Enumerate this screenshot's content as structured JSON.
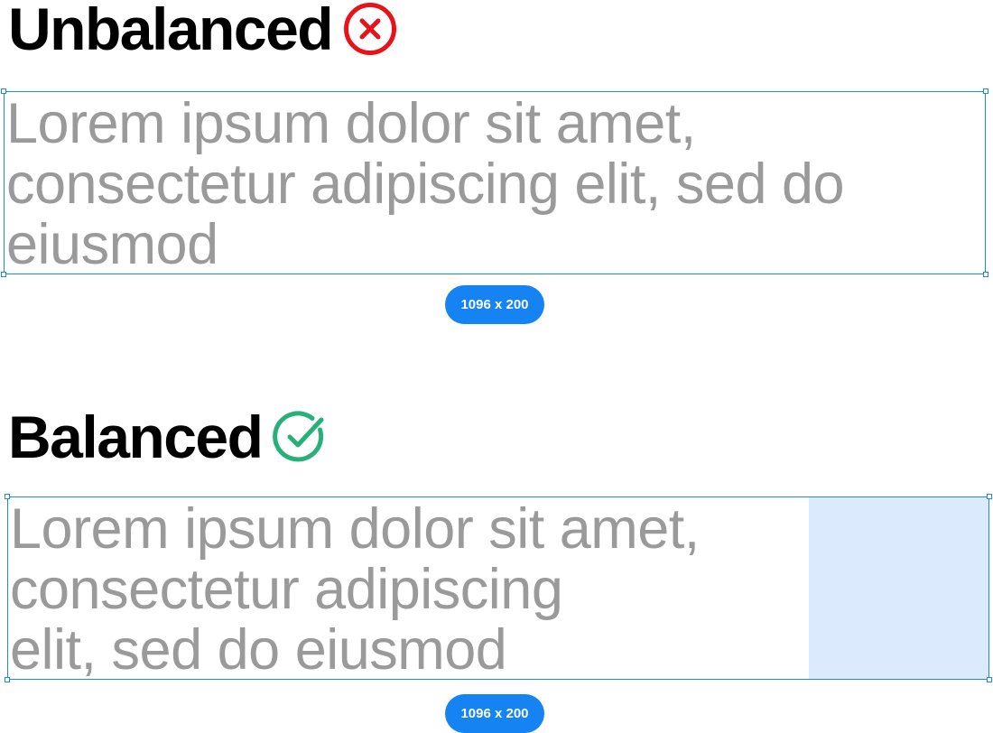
{
  "unbalanced": {
    "heading": "Unbalanced",
    "status_icon": "x-circle-icon",
    "status_color": "#e8121a",
    "text_lines": [
      "Lorem ipsum dolor sit amet,",
      "consectetur adipiscing elit, sed do",
      "eiusmod"
    ],
    "size_label": "1096 x 200"
  },
  "balanced": {
    "heading": "Balanced",
    "status_icon": "check-circle-icon",
    "status_color": "#27b07a",
    "text_lines": [
      "Lorem ipsum dolor sit amet,",
      "consectetur adipiscing",
      "elit, sed do eiusmod"
    ],
    "size_label": "1096 x 200"
  },
  "colors": {
    "frame_border": "#1f8bd6",
    "pill_background": "#1683f3",
    "sample_text": "#9a9a9a",
    "slack_highlight": "#dbeafd"
  }
}
